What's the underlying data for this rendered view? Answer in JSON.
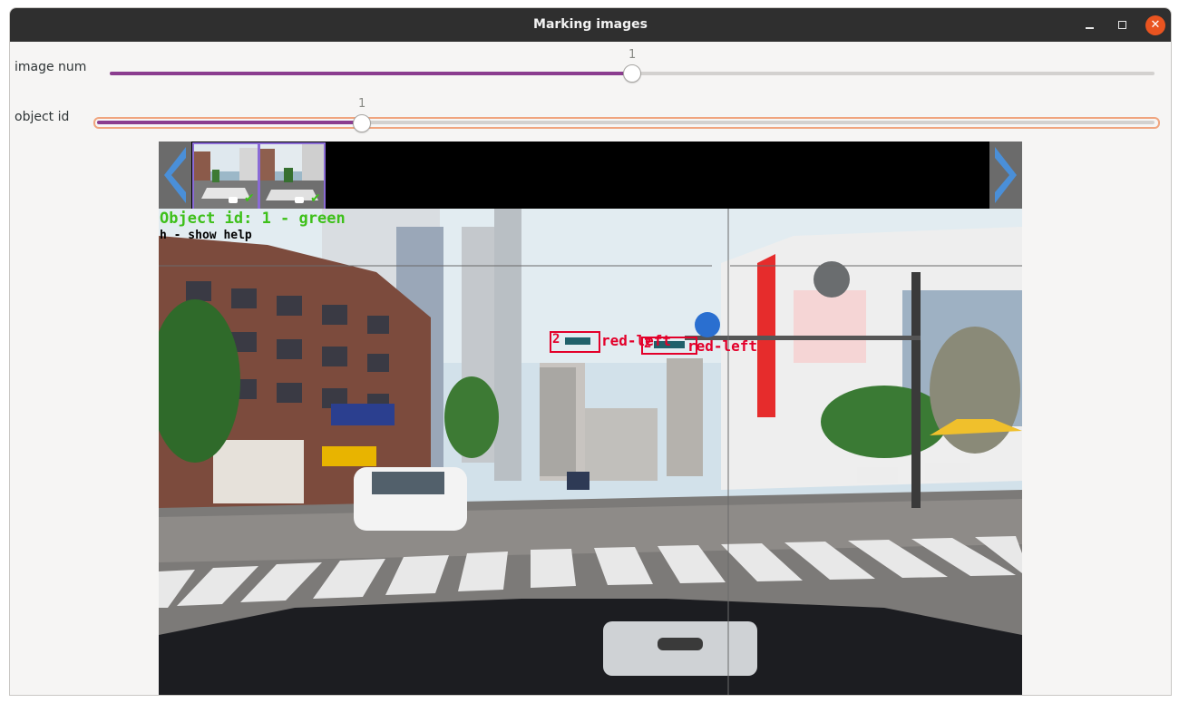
{
  "window": {
    "title": "Marking images"
  },
  "controls": {
    "image_num": {
      "label": "image num",
      "value": "1",
      "fraction": 0.5
    },
    "object_id": {
      "label": "object id",
      "value": "1",
      "fraction": 0.25
    }
  },
  "overlay": {
    "object_text": "Object id: 1   - green",
    "help_text": "h - show help",
    "boxes": [
      {
        "id": "2",
        "label": "red-left"
      },
      {
        "id": "2",
        "label": "red-left"
      }
    ]
  },
  "icons": [
    "minimize-icon",
    "maximize-icon",
    "close-icon",
    "prev-arrow-icon",
    "next-arrow-icon",
    "checkmark-icon",
    "camera-icon"
  ],
  "colors": {
    "accent": "#8b3d8f",
    "close": "#e95420",
    "green_text": "#3ec01a",
    "box_red": "#e3002a",
    "thumb_border": "#8a6bd6",
    "arrow_blue": "#4a8fd8"
  }
}
